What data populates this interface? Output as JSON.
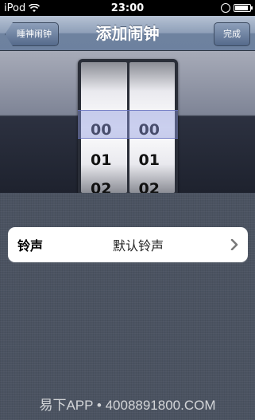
{
  "status_bar": {
    "carrier": "iPod",
    "time": "23:00",
    "icons": [
      "wifi-icon",
      "rotation-lock-icon",
      "battery-icon"
    ],
    "battery_level": 0.9
  },
  "nav": {
    "back_label": "睡神闹钟",
    "title": "添加闹钟",
    "done_label": "完成"
  },
  "picker": {
    "columns": [
      {
        "items": [
          "00",
          "01",
          "02"
        ],
        "selected": "00"
      },
      {
        "items": [
          "00",
          "01",
          "02"
        ],
        "selected": "00"
      }
    ]
  },
  "ringtone": {
    "label": "铃声",
    "value": "默认铃声",
    "icon": "chevron-right-icon"
  },
  "watermark": "易下APP • 4008891800.COM"
}
